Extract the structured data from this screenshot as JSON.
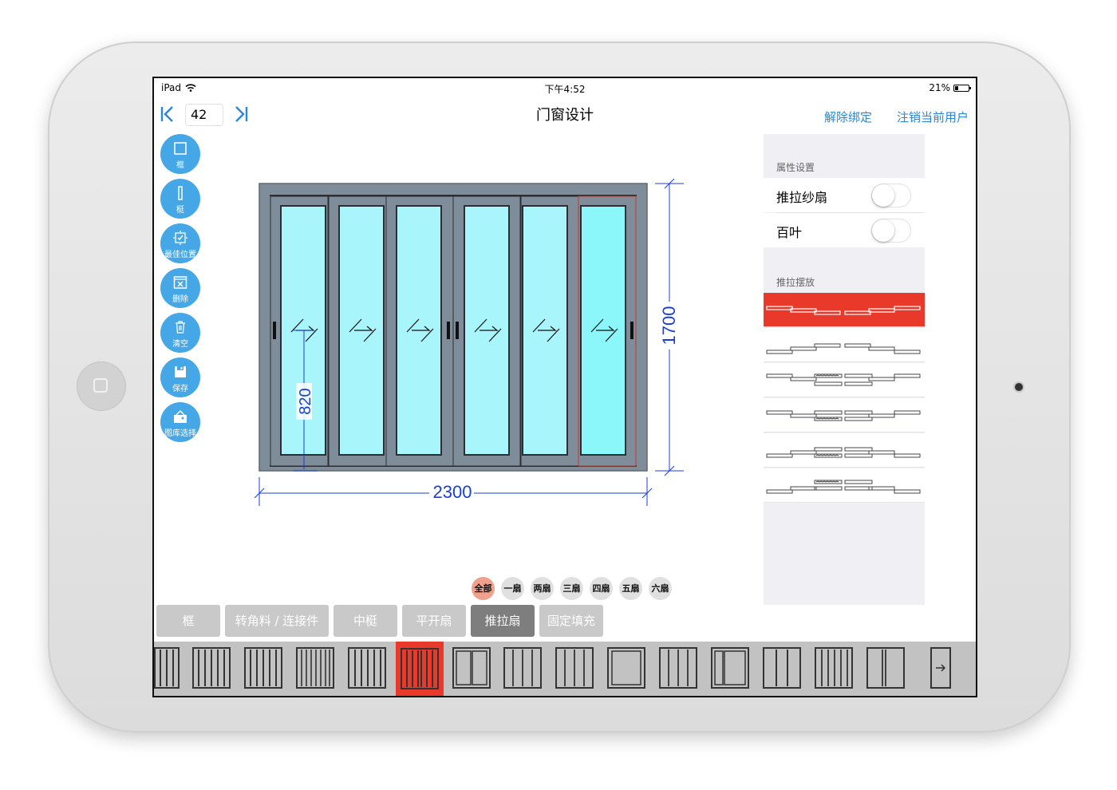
{
  "status_bar": {
    "device": "iPad",
    "time": "下午4:52",
    "battery": "21%"
  },
  "nav": {
    "title": "门窗设计",
    "page_number": "42",
    "unbind_label": "解除绑定",
    "logout_label": "注销当前用户"
  },
  "tools": [
    {
      "label": "框",
      "icon": "frame-icon"
    },
    {
      "label": "梃",
      "icon": "mullion-icon"
    },
    {
      "label": "最佳位置",
      "icon": "best-position-icon"
    },
    {
      "label": "删除",
      "icon": "delete-icon"
    },
    {
      "label": "清空",
      "icon": "trash-icon"
    },
    {
      "label": "保存",
      "icon": "save-icon"
    },
    {
      "label": "图库选择",
      "icon": "gallery-icon"
    }
  ],
  "design": {
    "width": "2300",
    "height": "1700",
    "handle_height": "820",
    "panel_count": 6
  },
  "properties": {
    "title": "属性设置",
    "screen_sash": {
      "label": "推拉纱扇",
      "on": false
    },
    "louver": {
      "label": "百叶",
      "on": false
    },
    "layout_title": "推拉摆放",
    "layout_selected": 0
  },
  "filters": [
    "全部",
    "一扇",
    "两扇",
    "三扇",
    "四扇",
    "五扇",
    "六扇"
  ],
  "tabs": [
    "框",
    "转角料 / 连接件",
    "中梃",
    "平开扇",
    "推拉扇",
    "固定填充"
  ],
  "active_tab": 4,
  "colors": {
    "accent": "#2a86d8",
    "tool": "#45a7e6",
    "selected": "#e8392b",
    "glass": "#a8f5fb",
    "frame": "#7f8c99",
    "dimension": "#1a3ed8"
  }
}
